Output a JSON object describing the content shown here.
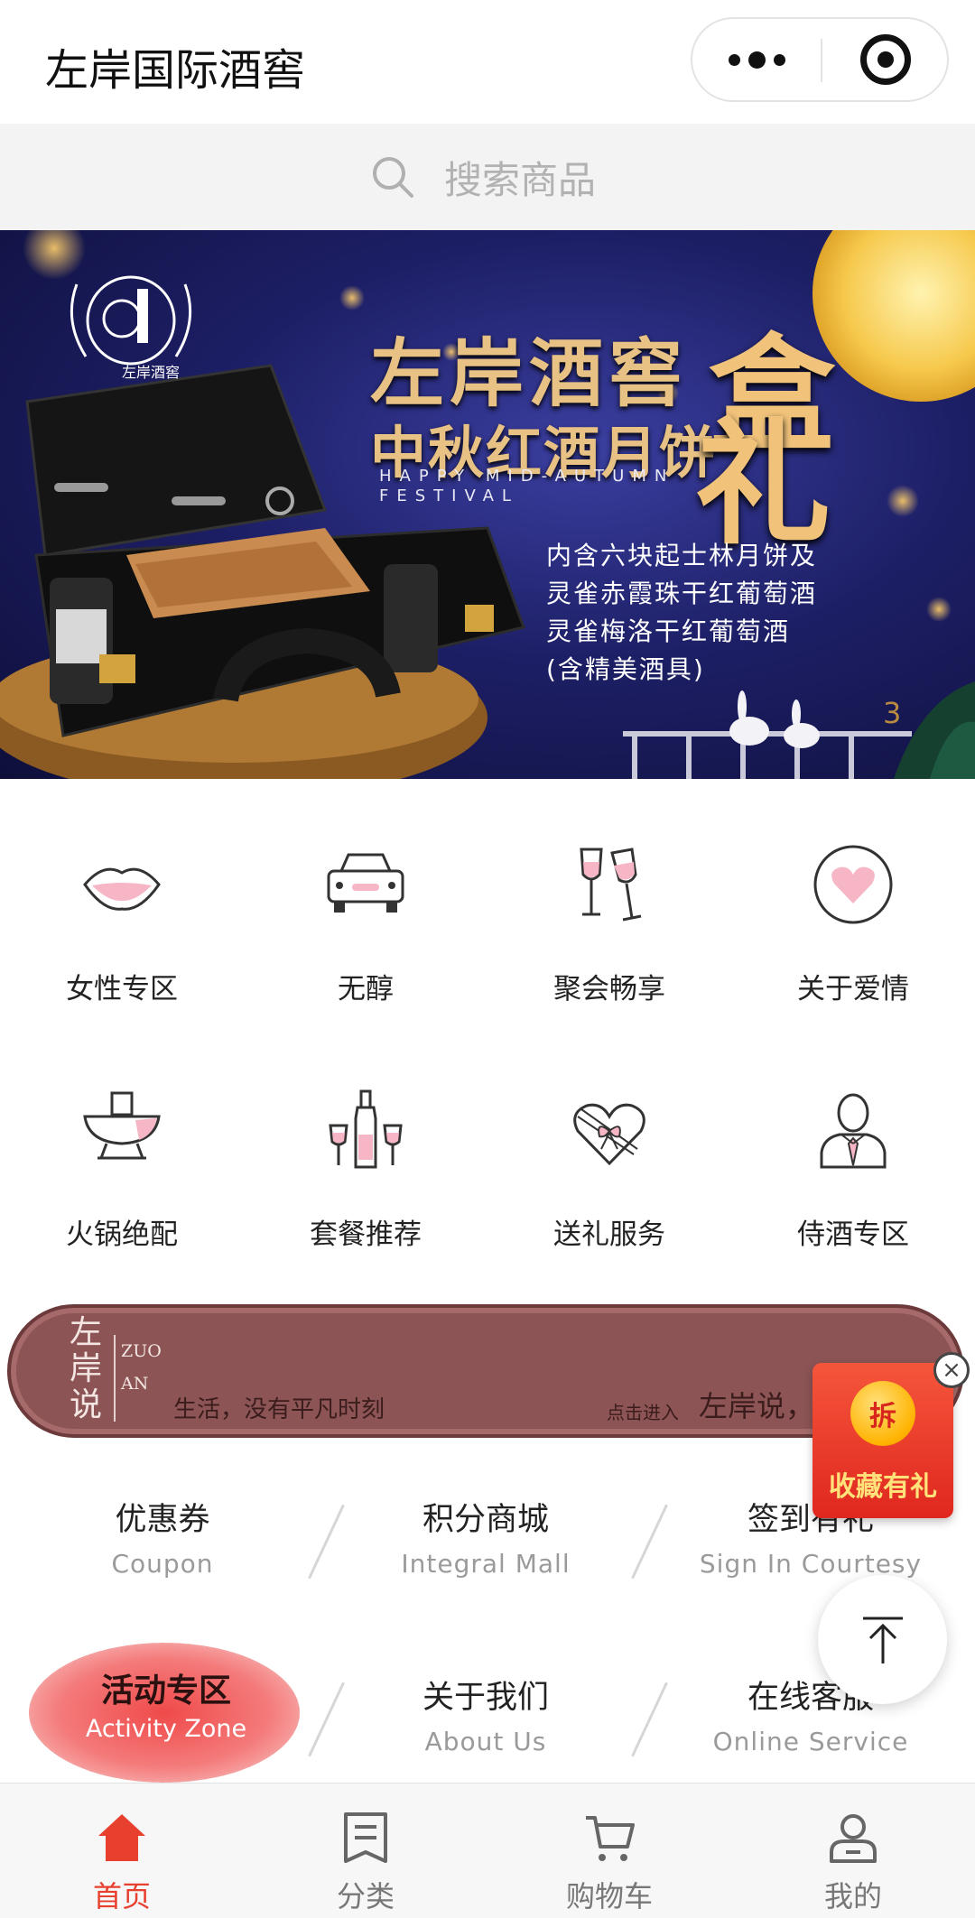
{
  "nav": {
    "title": "左岸国际酒窖"
  },
  "search": {
    "placeholder": "搜索商品"
  },
  "banner": {
    "brand": "左岸酒窖",
    "title": "左岸酒窖",
    "subtitle": "中秋红酒月饼",
    "big_char_1": "盒",
    "big_char_2": "礼",
    "english": "HAPPY MID-AUTUMN FESTIVAL",
    "desc": [
      "内含六块起士林月饼及",
      "灵雀赤霞珠干红葡萄酒",
      "灵雀梅洛干红葡萄酒",
      "(含精美酒具)"
    ],
    "page": "3"
  },
  "categories": [
    {
      "label": "女性专区",
      "icon": "lips-icon"
    },
    {
      "label": "无醇",
      "icon": "car-icon"
    },
    {
      "label": "聚会畅享",
      "icon": "wine-glasses-icon"
    },
    {
      "label": "关于爱情",
      "icon": "heart-icon"
    },
    {
      "label": "火锅绝配",
      "icon": "hotpot-icon"
    },
    {
      "label": "套餐推荐",
      "icon": "wine-set-icon"
    },
    {
      "label": "送礼服务",
      "icon": "gift-heart-icon"
    },
    {
      "label": "侍酒专区",
      "icon": "sommelier-icon"
    }
  ],
  "zuoan": {
    "left": "左岸说",
    "en1": "ZUO",
    "en2": "AN",
    "slogan": "生活，没有平凡时刻",
    "enter_small": "点击进入",
    "enter_big": "左岸说，"
  },
  "promo": {
    "coin": "拆",
    "text": "收藏有礼",
    "close": "×"
  },
  "quick_links": {
    "coupon": {
      "cn": "优惠券",
      "en": "Coupon"
    },
    "mall": {
      "cn": "积分商城",
      "en": "Integral Mall"
    },
    "signin": {
      "cn": "签到有礼",
      "en": "Sign In Courtesy"
    },
    "activity": {
      "cn": "活动专区",
      "en": "Activity Zone"
    },
    "about": {
      "cn": "关于我们",
      "en": "About Us"
    },
    "service": {
      "cn": "在线客服",
      "en": "Online Service"
    }
  },
  "tabs": [
    {
      "label": "首页",
      "icon": "home-icon",
      "active": true
    },
    {
      "label": "分类",
      "icon": "category-icon",
      "active": false
    },
    {
      "label": "购物车",
      "icon": "cart-icon",
      "active": false
    },
    {
      "label": "我的",
      "icon": "user-icon",
      "active": false
    }
  ],
  "colors": {
    "accent": "#e8402f",
    "banner_bg": "#1d1f66",
    "zuoan_bg": "#8c5455",
    "pink": "#f7b6c6"
  }
}
